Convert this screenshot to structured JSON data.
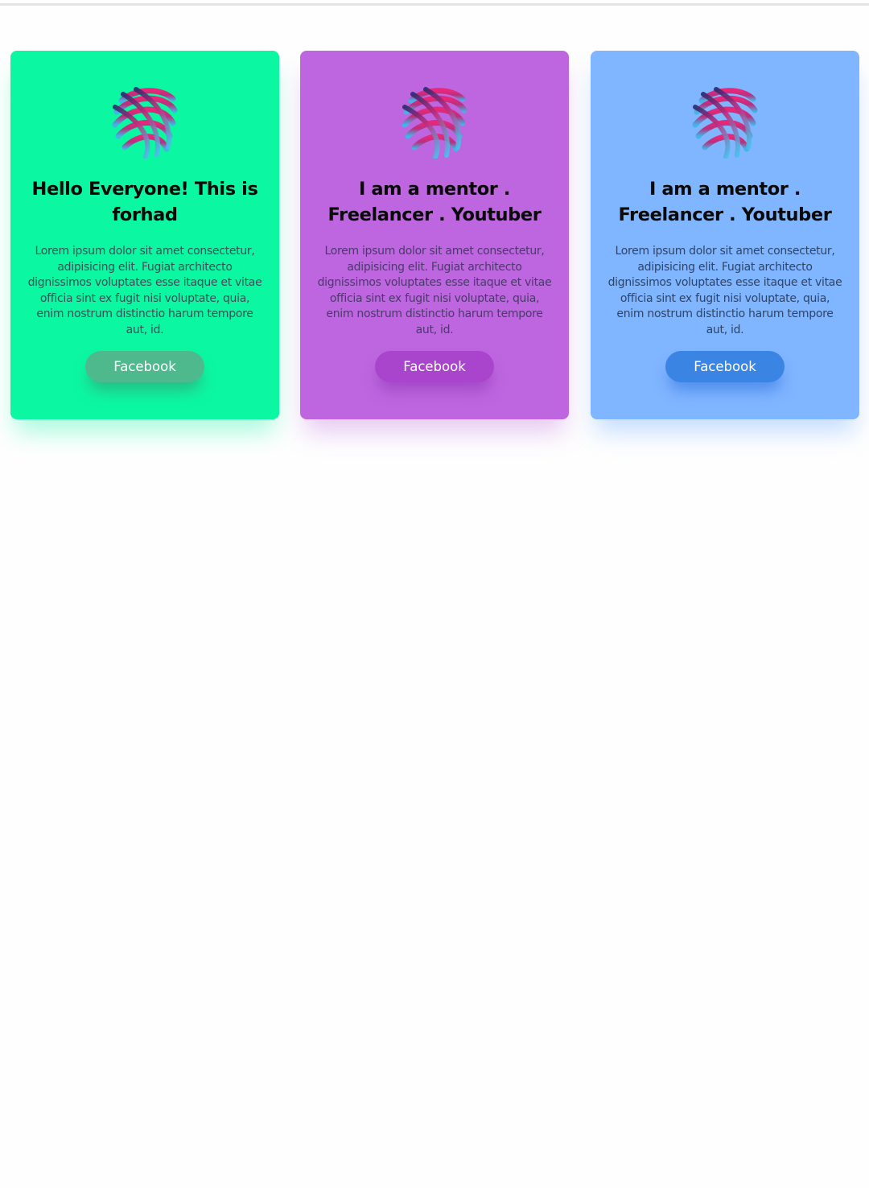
{
  "cards": [
    {
      "title": "Hello Everyone! This is forhad",
      "text": "Lorem ipsum dolor sit amet consectetur, adipisicing elit. Fugiat architecto dignissimos voluptates esse itaque et vitae officia sint ex fugit nisi voluptate, quia, enim nostrum distinctio harum tempore aut, id.",
      "button_label": "Facebook",
      "background": "#0cf7a2",
      "button_color": "#4fb98e",
      "logo_icon": "striped-globe-logo-icon"
    },
    {
      "title": "I am a mentor . Freelancer . Youtuber",
      "text": "Lorem ipsum dolor sit amet consectetur, adipisicing elit. Fugiat architecto dignissimos voluptates esse itaque et vitae officia sint ex fugit nisi voluptate, quia, enim nostrum distinctio harum tempore aut, id.",
      "button_label": "Facebook",
      "background": "#bd66df",
      "button_color": "#a945cc",
      "logo_icon": "striped-globe-logo-icon"
    },
    {
      "title": "I am a mentor . Freelancer . Youtuber",
      "text": "Lorem ipsum dolor sit amet consectetur, adipisicing elit. Fugiat architecto dignissimos voluptates esse itaque et vitae officia sint ex fugit nisi voluptate, quia, enim nostrum distinctio harum tempore aut, id.",
      "button_label": "Facebook",
      "background": "#80b5ff",
      "button_color": "#3a84e4",
      "logo_icon": "striped-globe-logo-icon"
    }
  ]
}
